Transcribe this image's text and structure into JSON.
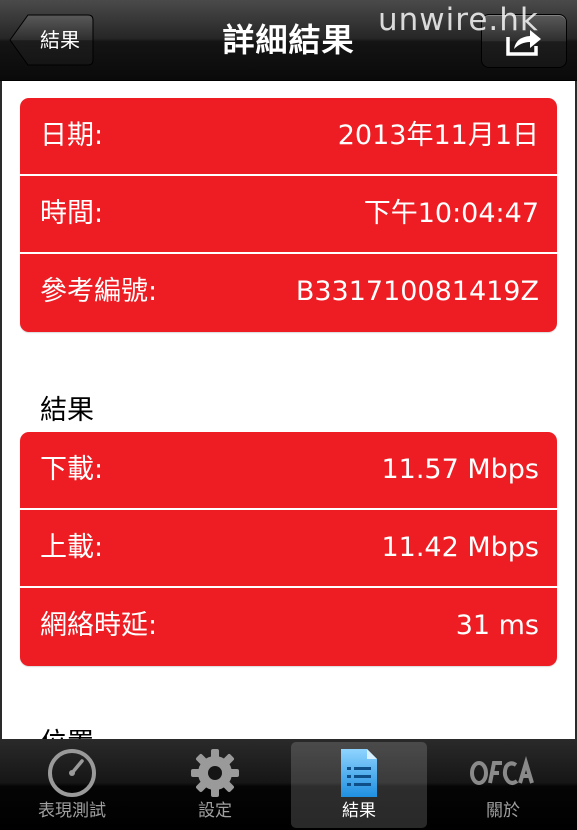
{
  "nav": {
    "back_label": "結果",
    "title": "詳細結果",
    "watermark": "unwire.hk"
  },
  "info_group": {
    "rows": [
      {
        "label": "日期:",
        "value": "2013年11月1日"
      },
      {
        "label": "時間:",
        "value": "下午10:04:47"
      },
      {
        "label": "參考編號:",
        "value": "B331710081419Z"
      }
    ]
  },
  "results_section": {
    "header": "結果",
    "rows": [
      {
        "label": "下載:",
        "value": "11.57 Mbps"
      },
      {
        "label": "上載:",
        "value": "11.42 Mbps"
      },
      {
        "label": "網絡時延:",
        "value": "31 ms"
      }
    ]
  },
  "next_section": {
    "header": "位置"
  },
  "tabbar": {
    "tabs": [
      {
        "label": "表現測試",
        "icon": "speedometer-icon",
        "selected": false
      },
      {
        "label": "設定",
        "icon": "gear-icon",
        "selected": false
      },
      {
        "label": "結果",
        "icon": "document-list-icon",
        "selected": true
      },
      {
        "label": "關於",
        "icon": "ofca-logo-icon",
        "selected": false
      }
    ]
  },
  "colors": {
    "group_red": "#ee1d23",
    "nav_dark": "#1a1a1a"
  }
}
